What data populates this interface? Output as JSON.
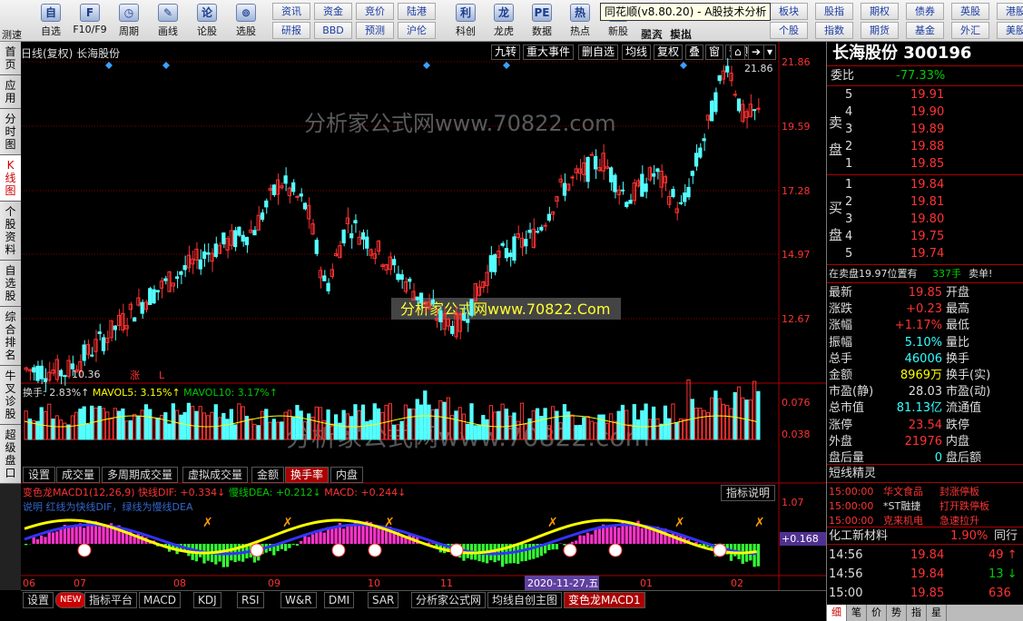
{
  "app": {
    "window_title": "同花顺(v8.80.20) - A股技术分析"
  },
  "toolbar": {
    "main": [
      {
        "icon": "自",
        "label": "自选"
      },
      {
        "icon": "F",
        "label": "F10/F9"
      },
      {
        "icon": "◷",
        "label": "周期"
      },
      {
        "icon": "✎",
        "label": "画线"
      },
      {
        "icon": "论",
        "label": "论股"
      },
      {
        "icon": "⊚",
        "label": "选股"
      }
    ],
    "grid1": [
      "资讯",
      "资金",
      "竞价",
      "陆港",
      "研报",
      "BBD",
      "预测",
      "沪伦"
    ],
    "mid": [
      {
        "icon": "利",
        "label": "科创"
      },
      {
        "icon": "龙",
        "label": "龙虎"
      },
      {
        "icon": "PE",
        "label": "数据"
      },
      {
        "icon": "热",
        "label": "热点"
      },
      {
        "icon": "新",
        "label": "新股"
      }
    ],
    "buysell": [
      "买入",
      "卖出",
      "融资",
      "模拟"
    ],
    "grid2": [
      "板块",
      "股指",
      "期权",
      "债券",
      "英股",
      "港股",
      "个股",
      "指数",
      "期货",
      "基金",
      "外汇",
      "美股"
    ],
    "left_label": "测速"
  },
  "left_tabs": [
    "首页",
    "应用",
    "分时图",
    "K线图",
    "个股资料",
    "自选股",
    "综合排名",
    "牛叉诊股",
    "超级盘口"
  ],
  "chart": {
    "header_left": "日线(复权)  长海股份",
    "header_buttons": [
      "九转",
      "重大事件",
      "删自选",
      "均线",
      "复权",
      "叠",
      "窗",
      "预测"
    ],
    "price_axis": [
      "21.86",
      "19.59",
      "17.28",
      "14.97",
      "12.67"
    ],
    "high_label": "21.86",
    "low_label": "10.36",
    "zhang_mark": "涨",
    "l_mark": "L",
    "watermark1": "分析家公式网www.70822.com",
    "watermark2": "分析家公式网www.70822.Com",
    "watermark3": "分析家公式网www.70822.com",
    "vol_legend": {
      "huanshou": "换手: 2.83%↑",
      "mavol5": "MAVOL5: 3.15%↑",
      "mavol10": "MAVOL10: 3.17%↑"
    },
    "vol_axis": [
      "0.076",
      "0.038"
    ],
    "mid_tabs": [
      "设置",
      "成交量",
      "多周期成交量",
      "虚拟成交量",
      "金额",
      "换手率",
      "内盘"
    ],
    "mid_active": "换手率",
    "macd_legend": {
      "name": "变色龙MACD1(12,26,9)",
      "dif": "快线DIF: +0.334↓",
      "dea": "慢线DEA: +0.212↓",
      "macd": "MACD: +0.244↓"
    },
    "macd_note": "说明 红线为快线DIF，绿线为慢线DEA",
    "indicator_button": "指标说明",
    "macd_axis": [
      "1.07",
      "+0.168"
    ],
    "x_labels": [
      "06",
      "07",
      "08",
      "09",
      "10",
      "11",
      "01",
      "02"
    ],
    "cursor_date": "2020-11-27,五"
  },
  "bottom_tabs": [
    "设置",
    "NEW",
    "指标平台",
    "MACD",
    "KDJ",
    "RSI",
    "W&R",
    "DMI",
    "SAR",
    "分析家公式网",
    "均线自创主图",
    "变色龙MACD1"
  ],
  "bottom_active": "变色龙MACD1",
  "panel": {
    "title": "长海股份 300196",
    "weibi_label": "委比",
    "weibi": "-77.33%",
    "sell_label": "卖盘",
    "buy_label": "买盘",
    "sells": [
      {
        "n": "5",
        "p": "19.91"
      },
      {
        "n": "4",
        "p": "19.90"
      },
      {
        "n": "3",
        "p": "19.89"
      },
      {
        "n": "2",
        "p": "19.88"
      },
      {
        "n": "1",
        "p": "19.85"
      }
    ],
    "buys": [
      {
        "n": "1",
        "p": "19.84"
      },
      {
        "n": "2",
        "p": "19.81"
      },
      {
        "n": "3",
        "p": "19.80"
      },
      {
        "n": "4",
        "p": "19.75"
      },
      {
        "n": "5",
        "p": "19.74"
      }
    ],
    "zaimai": "在卖盘19.97位置有",
    "zaimai_vol": "337手",
    "zaimai_tag": "卖单!",
    "stats": [
      {
        "k1": "最新",
        "v1": "19.85",
        "c1": "r",
        "k2": "开盘"
      },
      {
        "k1": "涨跌",
        "v1": "+0.23",
        "c1": "r",
        "k2": "最高"
      },
      {
        "k1": "涨幅",
        "v1": "+1.17%",
        "c1": "r",
        "k2": "最低"
      },
      {
        "k1": "振幅",
        "v1": "5.10%",
        "c1": "c",
        "k2": "量比"
      },
      {
        "k1": "总手",
        "v1": "46006",
        "c1": "c",
        "k2": "换手"
      },
      {
        "k1": "金额",
        "v1": "8969万",
        "c1": "y",
        "k2": "换手(实)"
      },
      {
        "k1": "市盈(静)",
        "v1": "28.03",
        "c1": "w",
        "k2": "市盈(动)"
      },
      {
        "k1": "总市值",
        "v1": "81.13亿",
        "c1": "c",
        "k2": "流通值"
      },
      {
        "k1": "涨停",
        "v1": "23.54",
        "c1": "r",
        "k2": "跌停"
      },
      {
        "k1": "外盘",
        "v1": "21976",
        "c1": "r",
        "k2": "内盘"
      },
      {
        "k1": "盘后量",
        "v1": "0",
        "c1": "c",
        "k2": "盘后额"
      }
    ],
    "jingling_title": "短线精灵",
    "jingling": [
      {
        "t": "15:00:00",
        "s": "华文食品",
        "e": "封涨停板"
      },
      {
        "t": "15:00:00",
        "s": "*ST融捷",
        "e": "打开跌停板"
      },
      {
        "t": "15:00:00",
        "s": "克来机电",
        "e": "急速拉升"
      }
    ],
    "sector": "化工新材料",
    "sector_pct": "1.90%",
    "sector_more": "同行",
    "ticks": [
      {
        "t": "14:56",
        "p": "19.84",
        "v": "49",
        "d": "↑",
        "c": "r"
      },
      {
        "t": "14:56",
        "p": "19.84",
        "v": "13",
        "d": "↓",
        "c": "g"
      },
      {
        "t": "15:00",
        "p": "19.85",
        "v": "636",
        "d": "↑",
        "c": "r"
      }
    ],
    "bottom_tabs": [
      "细",
      "笔",
      "价",
      "势",
      "指",
      "星"
    ]
  },
  "colors": {
    "up": "#ff3232",
    "down": "#54ffff",
    "bg": "#000000",
    "grid": "#7a0000"
  }
}
